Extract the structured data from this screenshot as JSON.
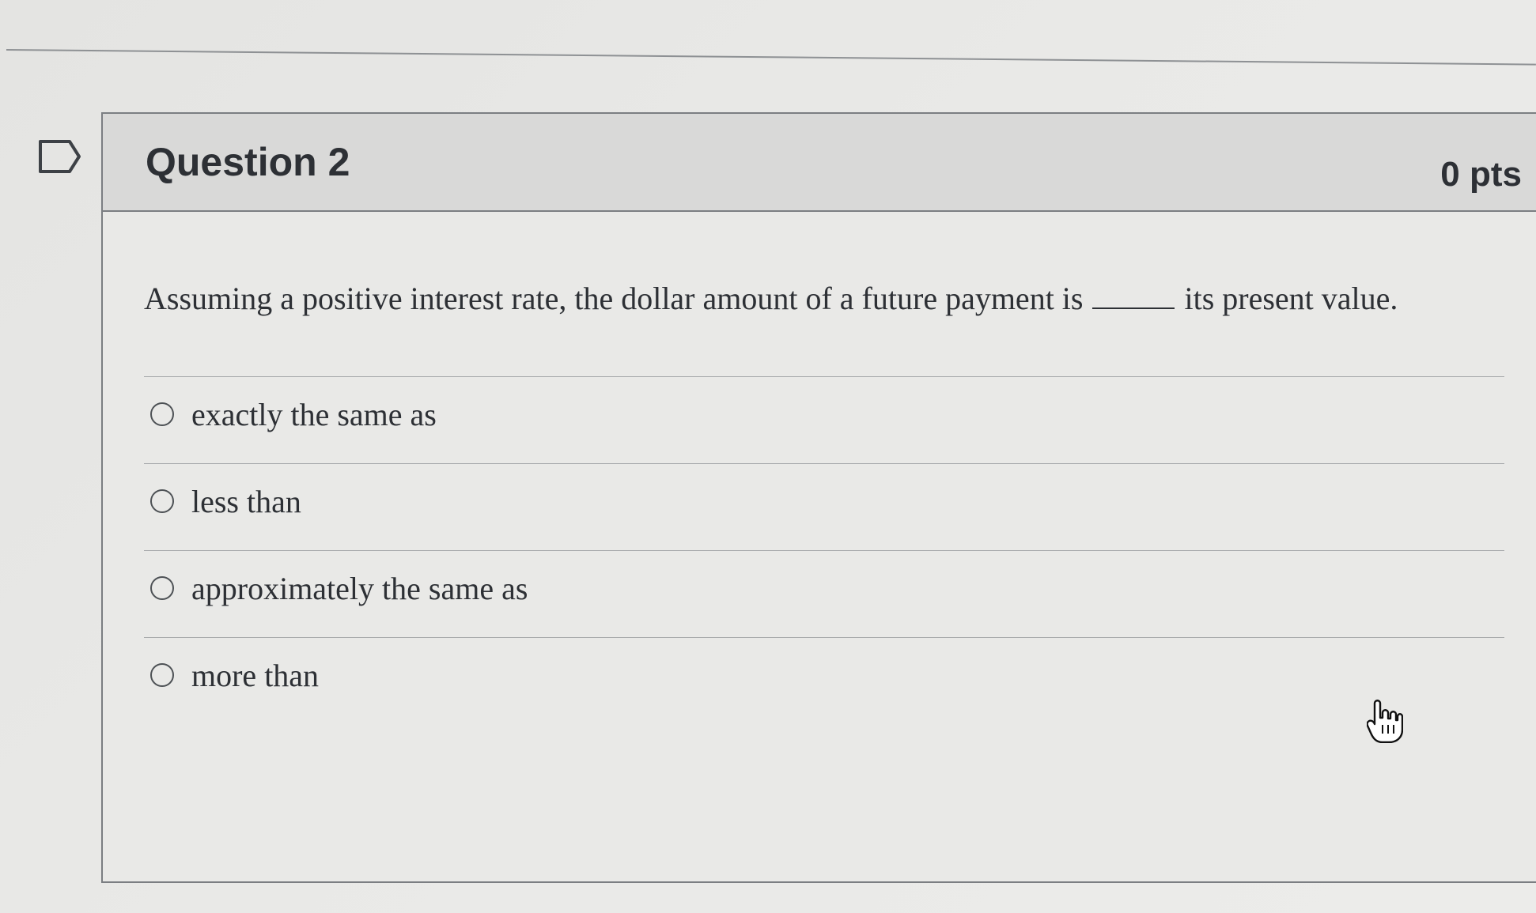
{
  "question": {
    "title": "Question 2",
    "points": "0 pts",
    "text_before_blank": "Assuming a positive interest rate, the dollar amount of a future payment is",
    "text_after_blank": "its present value.",
    "answers": [
      {
        "label": "exactly the same as",
        "selected": false
      },
      {
        "label": "less than",
        "selected": false
      },
      {
        "label": "approximately the same as",
        "selected": false
      },
      {
        "label": "more than",
        "selected": false
      }
    ]
  },
  "icons": {
    "flag": "flag-icon",
    "cursor": "hand-pointer-icon"
  },
  "colors": {
    "header_background": "#d9d9d8",
    "card_background": "#e9e9e7",
    "text": "#2d3035",
    "border": "#7b7e82"
  }
}
